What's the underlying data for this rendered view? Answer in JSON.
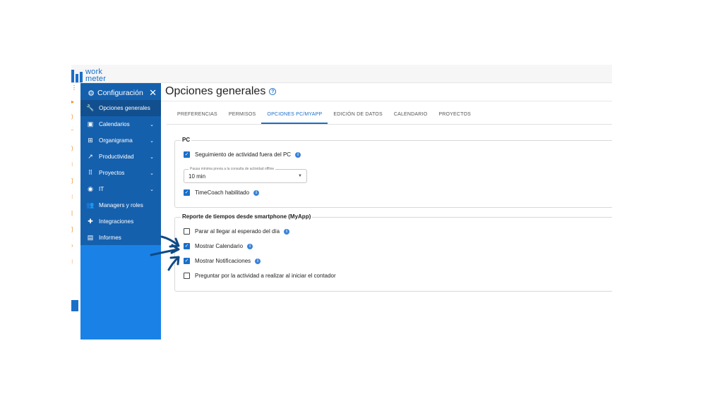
{
  "brand": {
    "logo_line1": "work",
    "logo_line2": "meter",
    "color": "#1a6fc9"
  },
  "sidebar": {
    "header": {
      "title": "Configuración",
      "icon": "gear-icon"
    },
    "close_icon": "✕",
    "items": [
      {
        "label": "Opciones generales",
        "icon": "wrench-icon",
        "glyph": "🔧",
        "active": true
      },
      {
        "label": "Calendarios",
        "icon": "calendar-icon",
        "glyph": "▣",
        "chevron": "⌄"
      },
      {
        "label": "Organigrama",
        "icon": "org-chart-icon",
        "glyph": "⊞",
        "chevron": "⌄"
      },
      {
        "label": "Productividad",
        "icon": "trend-icon",
        "glyph": "↗",
        "chevron": "⌄"
      },
      {
        "label": "Proyectos",
        "icon": "grid-icon",
        "glyph": "⠿",
        "chevron": "⌄"
      },
      {
        "label": "IT",
        "icon": "palette-icon",
        "glyph": "◉",
        "chevron": "⌄"
      },
      {
        "label": "Managers y roles",
        "icon": "users-icon",
        "glyph": "👥"
      },
      {
        "label": "Integraciones",
        "icon": "puzzle-icon",
        "glyph": "✚"
      },
      {
        "label": "Informes",
        "icon": "report-icon",
        "glyph": "▤"
      }
    ],
    "bg_color": "#1a82e6",
    "menu_color": "#1560ad"
  },
  "main": {
    "title": "Opciones generales",
    "help_glyph": "?",
    "tabs": [
      {
        "label": "PREFERENCIAS"
      },
      {
        "label": "PERMISOS"
      },
      {
        "label": "OPCIONES PC/MYAPP",
        "active": true
      },
      {
        "label": "EDICIÓN DE DATOS"
      },
      {
        "label": "CALENDARIO"
      },
      {
        "label": "PROYECTOS"
      }
    ],
    "pc_section": {
      "legend": "PC",
      "tracking": {
        "label": "Seguimiento de actividad fuera del PC",
        "checked": true
      },
      "pause": {
        "label": "Pausa mínima previa a la consulta de actividad offline",
        "value": "10 min"
      },
      "timecoach": {
        "label": "TimeCoach habilitado",
        "checked": true
      }
    },
    "myapp_section": {
      "legend": "Reporte de tiempos desde smartphone (MyApp)",
      "options": [
        {
          "label": "Parar al llegar al esperado del día",
          "checked": false,
          "info": true
        },
        {
          "label": "Mostrar Calendario",
          "checked": true,
          "info": true
        },
        {
          "label": "Mostrar Notificaciones",
          "checked": true,
          "info": true
        },
        {
          "label": "Preguntar por la actividad a realizar al iniciar el contador",
          "checked": false,
          "info": false
        }
      ]
    },
    "accent_color": "#1a6fc9"
  },
  "annotation": {
    "arrow_color": "#0f4a86"
  }
}
